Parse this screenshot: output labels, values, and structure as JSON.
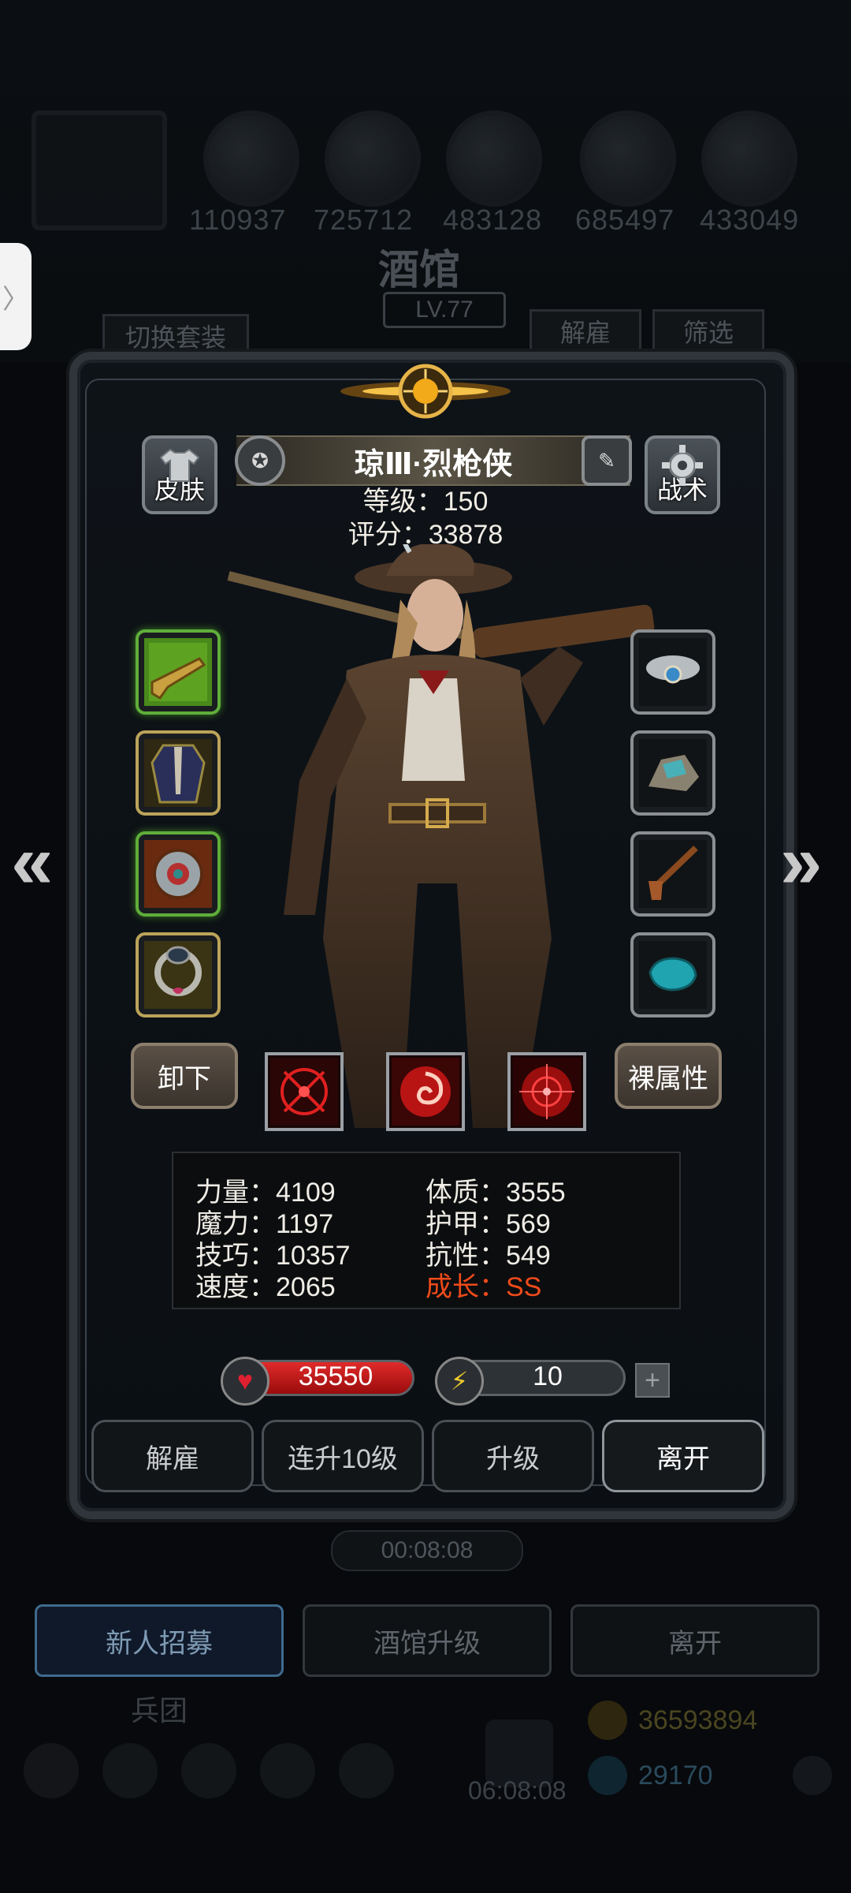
{
  "background": {
    "resources": [
      "110937",
      "725712",
      "483128",
      "685497",
      "433049"
    ],
    "tavern_title": "酒馆",
    "tavern_level": "LV.77",
    "switch_outfit": "切换套装",
    "dismiss": "解雇",
    "filter": "筛选",
    "timer": "00:08:08",
    "bottom_buttons": [
      "新人招募",
      "酒馆升级",
      "离开"
    ],
    "regiment": "兵团",
    "gold": "36593894",
    "gems": "29170",
    "clock": "06:08:08"
  },
  "hero": {
    "name": "琼Ⅲ·烈枪侠",
    "level_text": "等级：150",
    "score_text": "评分：33878",
    "skin_label": "皮肤",
    "tactics_label": "战术",
    "unequip_label": "卸下",
    "bare_attr_label": "裸属性"
  },
  "stats": {
    "left": [
      "力量：4109",
      "魔力：1197",
      "技巧：10357",
      "速度：2065"
    ],
    "right": [
      "体质：3555",
      "护甲：569",
      "抗性：549"
    ],
    "growth": "成长：SS"
  },
  "bars": {
    "hp": "35550",
    "energy": "10",
    "energy_fill_fraction": 0.08
  },
  "actions": [
    "解雇",
    "连升10级",
    "升级",
    "离开"
  ],
  "colors": {
    "hp_red": "#c0161c",
    "energy_yellow": "#e1c21f",
    "growth_orange": "#f04b1a"
  },
  "icons": {
    "left_slots": [
      "shotgun-icon",
      "coat-icon",
      "amulet-icon",
      "ring-icon"
    ],
    "right_slots": [
      "cloud-charm-icon",
      "gem-ore-icon",
      "pipe-icon",
      "turquoise-icon"
    ],
    "skills": [
      "crosshair-skill-icon",
      "swirl-skill-icon",
      "target-skill-icon"
    ]
  }
}
